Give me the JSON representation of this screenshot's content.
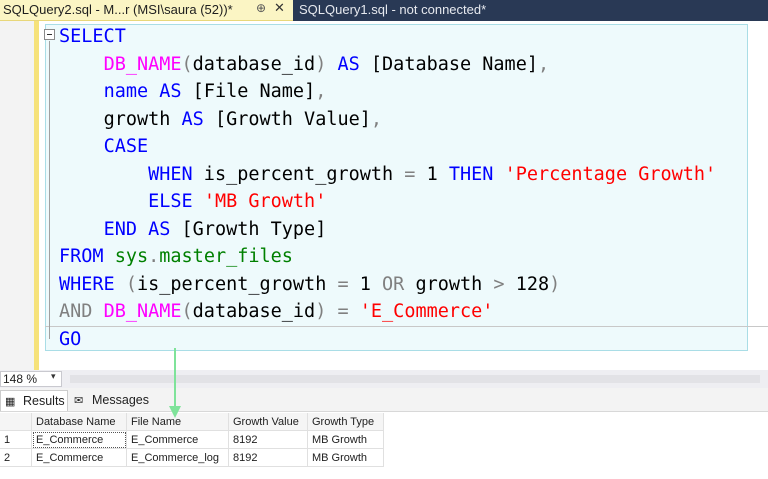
{
  "tabs": [
    {
      "title": "SQLQuery2.sql - M...r (MSI\\saura (52))*",
      "pin": "⊕",
      "close": "✕",
      "active": true
    },
    {
      "title": "SQLQuery1.sql - not connected*",
      "active": false
    }
  ],
  "editor": {
    "lines": [
      [
        {
          "t": "SELECT",
          "c": "kw"
        }
      ],
      [
        {
          "t": "    "
        },
        {
          "t": "DB_NAME",
          "c": "fn"
        },
        {
          "t": "(",
          "c": "gr"
        },
        {
          "t": "database_id",
          "c": "tx"
        },
        {
          "t": ")",
          "c": "gr"
        },
        {
          "t": " "
        },
        {
          "t": "AS",
          "c": "kw"
        },
        {
          "t": " [Database Name]",
          "c": "tx"
        },
        {
          "t": ",",
          "c": "gr"
        }
      ],
      [
        {
          "t": "    "
        },
        {
          "t": "name",
          "c": "kw"
        },
        {
          "t": " "
        },
        {
          "t": "AS",
          "c": "kw"
        },
        {
          "t": " [File Name]",
          "c": "tx"
        },
        {
          "t": ",",
          "c": "gr"
        }
      ],
      [
        {
          "t": "    "
        },
        {
          "t": "growth",
          "c": "tx"
        },
        {
          "t": " "
        },
        {
          "t": "AS",
          "c": "kw"
        },
        {
          "t": " [Growth Value]",
          "c": "tx"
        },
        {
          "t": ",",
          "c": "gr"
        }
      ],
      [
        {
          "t": "    "
        },
        {
          "t": "CASE",
          "c": "kw"
        }
      ],
      [
        {
          "t": "        "
        },
        {
          "t": "WHEN",
          "c": "kw"
        },
        {
          "t": " is_percent_growth ",
          "c": "tx"
        },
        {
          "t": "=",
          "c": "gr"
        },
        {
          "t": " 1 ",
          "c": "tx"
        },
        {
          "t": "THEN",
          "c": "kw"
        },
        {
          "t": " "
        },
        {
          "t": "'Percentage Growth'",
          "c": "str"
        }
      ],
      [
        {
          "t": "        "
        },
        {
          "t": "ELSE",
          "c": "kw"
        },
        {
          "t": " "
        },
        {
          "t": "'MB Growth'",
          "c": "str"
        }
      ],
      [
        {
          "t": "    "
        },
        {
          "t": "END",
          "c": "kw"
        },
        {
          "t": " "
        },
        {
          "t": "AS",
          "c": "kw"
        },
        {
          "t": " [Growth Type]",
          "c": "tx"
        }
      ],
      [
        {
          "t": "FROM",
          "c": "kw"
        },
        {
          "t": " "
        },
        {
          "t": "sys",
          "c": "sys"
        },
        {
          "t": ".",
          "c": "gr"
        },
        {
          "t": "master_files",
          "c": "sys"
        }
      ],
      [
        {
          "t": "WHERE",
          "c": "kw"
        },
        {
          "t": " ",
          "c": "tx"
        },
        {
          "t": "(",
          "c": "gr"
        },
        {
          "t": "is_percent_growth ",
          "c": "tx"
        },
        {
          "t": "=",
          "c": "gr"
        },
        {
          "t": " 1 ",
          "c": "tx"
        },
        {
          "t": "OR",
          "c": "gr"
        },
        {
          "t": " growth ",
          "c": "tx"
        },
        {
          "t": ">",
          "c": "gr"
        },
        {
          "t": " 128",
          "c": "tx"
        },
        {
          "t": ")",
          "c": "gr"
        }
      ],
      [
        {
          "t": "AND",
          "c": "gr"
        },
        {
          "t": " "
        },
        {
          "t": "DB_NAME",
          "c": "fn"
        },
        {
          "t": "(",
          "c": "gr"
        },
        {
          "t": "database_id",
          "c": "tx"
        },
        {
          "t": ")",
          "c": "gr"
        },
        {
          "t": " "
        },
        {
          "t": "=",
          "c": "gr"
        },
        {
          "t": " "
        },
        {
          "t": "'E_Commerce'",
          "c": "str"
        }
      ],
      [
        {
          "t": "GO",
          "c": "kw"
        }
      ]
    ]
  },
  "zoom": {
    "value": "148 %",
    "arrow": "▾"
  },
  "results_tabs": [
    {
      "label": "Results",
      "icon": "▦"
    },
    {
      "label": "Messages",
      "icon": "✉"
    }
  ],
  "grid": {
    "columns": [
      "",
      "Database Name",
      "File Name",
      "Growth Value",
      "Growth Type"
    ],
    "rows": [
      [
        "1",
        "E_Commerce",
        "E_Commerce",
        "8192",
        "MB Growth"
      ],
      [
        "2",
        "E_Commerce",
        "E_Commerce_log",
        "8192",
        "MB Growth"
      ]
    ]
  },
  "colors": {
    "tab_active_bg": "#fbf5c4",
    "tabstrip_bg": "#293955",
    "keyword": "#0000ff",
    "function": "#ff00ff",
    "system_object": "#008000",
    "string": "#ff0000",
    "operator": "#808080",
    "annotation_arrow": "#7fe39a"
  }
}
